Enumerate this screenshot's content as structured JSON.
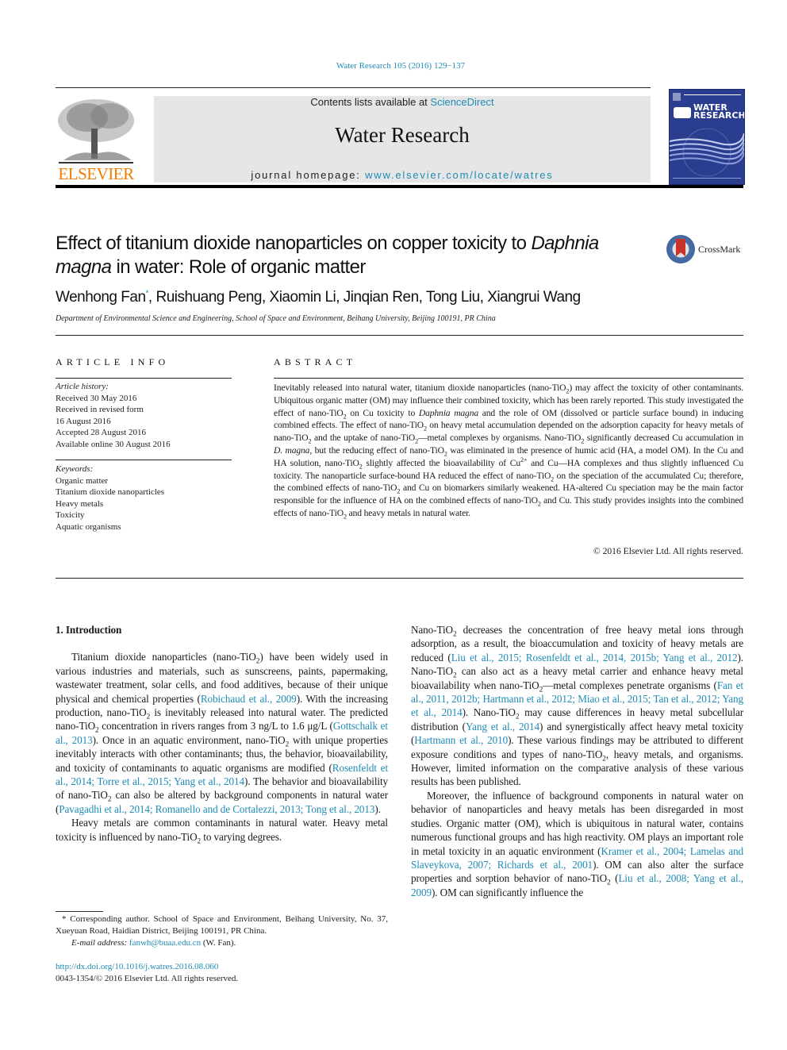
{
  "header": {
    "citation": "Water Research 105 (2016) 129−137",
    "publisher_wordmark": "ELSEVIER",
    "contents_prefix": "Contents lists available at ",
    "contents_link": "ScienceDirect",
    "journal_name": "Water Research",
    "homepage_prefix": "journal homepage: ",
    "homepage_link": "www.elsevier.com/locate/watres",
    "cover_title_line1": "WATER",
    "cover_title_line2": "RESEARCH",
    "crossmark_label": "CrossMark"
  },
  "colors": {
    "link": "#1f8bb6",
    "elsevier_orange": "#ef7d00",
    "masthead_bg": "#e6e6e6",
    "cover_blue": "#2a3d8f"
  },
  "article": {
    "title_part1": "Effect of titanium dioxide nanoparticles on copper toxicity to ",
    "title_italic1": "Daphnia magna",
    "title_part2": " in water: Role of organic matter",
    "first_author": "Wenhong Fan",
    "author_mark": "*",
    "other_authors": ", Ruishuang Peng, Xiaomin Li, Jinqian Ren, Tong Liu, Xiangrui Wang",
    "affiliation": "Department of Environmental Science and Engineering, School of Space and Environment, Beihang University, Beijing 100191, PR China"
  },
  "article_info": {
    "heading": "ARTICLE INFO",
    "history_label": "Article history:",
    "history": [
      "Received 30 May 2016",
      "Received in revised form",
      "16 August 2016",
      "Accepted 28 August 2016",
      "Available online 30 August 2016"
    ],
    "keywords_label": "Keywords:",
    "keywords": [
      "Organic matter",
      "Titanium dioxide nanoparticles",
      "Heavy metals",
      "Toxicity",
      "Aquatic organisms"
    ]
  },
  "abstract": {
    "heading": "ABSTRACT",
    "s1": "Inevitably released into natural water, titanium dioxide nanoparticles (nano-TiO",
    "s2": ") may affect the toxicity of other contaminants. Ubiquitous organic matter (OM) may influence their combined toxicity, which has been rarely reported. This study investigated the effect of nano-TiO",
    "s3": " on Cu toxicity to ",
    "s3i": "Daphnia magna",
    "s4": " and the role of OM (dissolved or particle surface bound) in inducing combined effects. The effect of nano-TiO",
    "s5": " on heavy metal accumulation depended on the adsorption capacity for heavy metals of nano-TiO",
    "s6": " and the uptake of nano-TiO",
    "s7": "—metal complexes by organisms. Nano-TiO",
    "s8": " significantly decreased Cu accumulation in ",
    "s8i": "D. magna",
    "s9": ", but the reducing effect of nano-TiO",
    "s10": " was eliminated in the presence of humic acid (HA, a model OM). In the Cu and HA solution, nano-TiO",
    "s11": " slightly affected the bioavailability of Cu",
    "s11sup": "2+",
    "s12": " and Cu—HA complexes and thus slightly influenced Cu toxicity. The nanoparticle surface-bound HA reduced the effect of nano-TiO",
    "s13": " on the speciation of the accumulated Cu; therefore, the combined effects of nano-TiO",
    "s14": " and Cu on biomarkers similarly weakened. HA-altered Cu speciation may be the main factor responsible for the influence of HA on the combined effects of nano-TiO",
    "s15": " and Cu. This study provides insights into the combined effects of nano-TiO",
    "s16": " and heavy metals in natural water.",
    "sub2": "2",
    "copyright": "© 2016 Elsevier Ltd. All rights reserved."
  },
  "body": {
    "section_heading": "1.  Introduction",
    "left": {
      "p1a": "Titanium dioxide nanoparticles (nano-TiO",
      "p1b": ") have been widely used in various industries and materials, such as sunscreens, paints, papermaking, wastewater treatment, solar cells, and food additives, because of their unique physical and chemical properties (",
      "ref1": "Robichaud et al., 2009",
      "p1c": "). With the increasing production, nano-TiO",
      "p1d": " is inevitably released into natural water. The predicted nano-TiO",
      "p1e": " concentration in rivers ranges from 3 ng/L to 1.6 μg/L (",
      "ref2": "Gottschalk et al., 2013",
      "p1f": "). Once in an aquatic environment, nano-TiO",
      "p1g": " with unique properties inevitably interacts with other contaminants; thus, the behavior, bioavailability, and toxicity of contaminants to aquatic organisms are modified (",
      "ref3": "Rosenfeldt et al., 2014; Torre et al., 2015; Yang et al., 2014",
      "p1h": "). The behavior and bioavailability of nano-TiO",
      "p1i": " can also be altered by background components in natural water (",
      "ref4": "Pavagadhi et al., 2014; Romanello and de Cortalezzi, 2013; Tong et al., 2013",
      "p1j": ").",
      "p2a": "Heavy metals are common contaminants in natural water. Heavy metal toxicity is influenced by nano-TiO",
      "p2b": " to varying degrees."
    },
    "right": {
      "p1a": "Nano-TiO",
      "p1b": " decreases the concentration of free heavy metal ions through adsorption, as a result, the bioaccumulation and toxicity of heavy metals are reduced (",
      "ref1": "Liu et al., 2015; Rosenfeldt et al., 2014, 2015b; Yang et al., 2012",
      "p1c": "). Nano-TiO",
      "p1d": " can also act as a heavy metal carrier and enhance heavy metal bioavailability when nano-TiO",
      "p1e": "—metal complexes penetrate organisms (",
      "ref2": "Fan et al., 2011, 2012b; Hartmann et al., 2012; Miao et al., 2015; Tan et al., 2012; Yang et al., 2014",
      "p1f": "). Nano-TiO",
      "p1g": " may cause differences in heavy metal subcellular distribution (",
      "ref3": "Yang et al., 2014",
      "p1h": ") and synergistically affect heavy metal toxicity (",
      "ref4": "Hartmann et al., 2010",
      "p1i": "). These various findings may be attributed to different exposure conditions and types of nano-TiO",
      "p1j": ", heavy metals, and organisms. However, limited information on the comparative analysis of these various results has been published.",
      "p2a": "Moreover, the influence of background components in natural water on behavior of nanoparticles and heavy metals has been disregarded in most studies. Organic matter (OM), which is ubiquitous in natural water, contains numerous functional groups and has high reactivity. OM plays an important role in metal toxicity in an aquatic environment (",
      "ref5": "Kramer et al., 2004; Lamelas and Slaveykova, 2007; Richards et al., 2001",
      "p2b": "). OM can also alter the surface properties and sorption behavior of nano-TiO",
      "p2c": " (",
      "ref6": "Liu et al., 2008; Yang et al., 2009",
      "p2d": "). OM can significantly influence the"
    }
  },
  "footnote": {
    "mark": "*",
    "text": " Corresponding author. School of Space and Environment, Beihang University, No. 37, Xueyuan Road, Haidian District, Beijing 100191, PR China.",
    "email_label": "E-mail address: ",
    "email": "fanwh@buaa.edu.cn",
    "email_suffix": " (W. Fan).",
    "doi": "http://dx.doi.org/10.1016/j.watres.2016.08.060",
    "issn": "0043-1354/© 2016 Elsevier Ltd. All rights reserved."
  }
}
